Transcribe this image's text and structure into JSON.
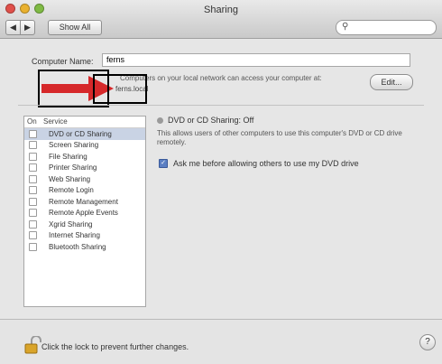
{
  "window": {
    "title": "Sharing"
  },
  "toolbar": {
    "back_icon": "◀",
    "forward_icon": "▶",
    "show_all_label": "Show All"
  },
  "search": {
    "icon": "magnifier-icon",
    "value": ""
  },
  "computer_name": {
    "label": "Computer Name:",
    "value": "ferns",
    "description": "Computers on your local network can access your computer at:",
    "address": "ferns.local",
    "edit_label": "Edit..."
  },
  "services": {
    "header_on": "On",
    "header_service": "Service",
    "items": [
      {
        "label": "DVD or CD Sharing",
        "on": false,
        "selected": true
      },
      {
        "label": "Screen Sharing",
        "on": false
      },
      {
        "label": "File Sharing",
        "on": false
      },
      {
        "label": "Printer Sharing",
        "on": false
      },
      {
        "label": "Web Sharing",
        "on": false
      },
      {
        "label": "Remote Login",
        "on": false
      },
      {
        "label": "Remote Management",
        "on": false
      },
      {
        "label": "Remote Apple Events",
        "on": false
      },
      {
        "label": "Xgrid Sharing",
        "on": false
      },
      {
        "label": "Internet Sharing",
        "on": false
      },
      {
        "label": "Bluetooth Sharing",
        "on": false
      }
    ]
  },
  "detail": {
    "status": "DVD or CD Sharing: Off",
    "description": "This allows users of other computers to use this computer's DVD or CD drive remotely.",
    "ask_label": "Ask me before allowing others to use my DVD drive",
    "ask_checked": true
  },
  "footer": {
    "lock_text": "Click the lock to prevent further changes.",
    "help_label": "?"
  }
}
